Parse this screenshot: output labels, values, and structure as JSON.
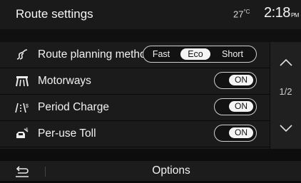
{
  "header": {
    "title": "Route settings",
    "temperature": "27",
    "temperature_unit": "°C",
    "time": "2:18",
    "ampm": "PM"
  },
  "settings": [
    {
      "label": "Route planning method",
      "icon": "route-planning-icon",
      "control": "segmented",
      "options": [
        "Fast",
        "Eco",
        "Short"
      ],
      "selected": "Eco"
    },
    {
      "label": "Motorways",
      "icon": "motorway-icon",
      "control": "toggle",
      "value": "ON"
    },
    {
      "label": "Period Charge",
      "icon": "period-charge-icon",
      "control": "toggle",
      "value": "ON"
    },
    {
      "label": "Per-use Toll",
      "icon": "toll-icon",
      "control": "toggle",
      "value": "ON"
    }
  ],
  "pagination": {
    "page_text": "1/2"
  },
  "footer": {
    "options_label": "Options"
  },
  "colors": {
    "background": "#0b0b0b",
    "panel": "#1b1b1b",
    "text": "#f2f2f2",
    "toggle_on": "#f4f4f4"
  }
}
